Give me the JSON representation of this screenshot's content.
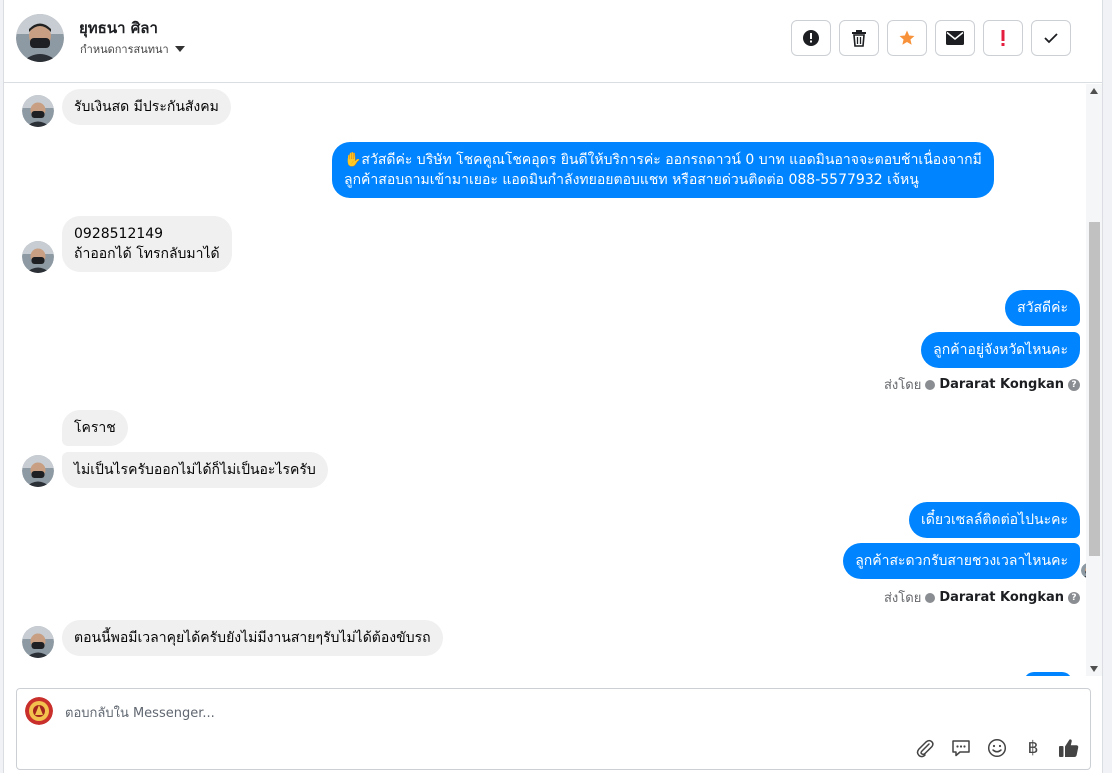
{
  "header": {
    "contact_name": "ยุทธนา ศิลา",
    "assign_label": "กำหนดการสนทนา"
  },
  "toolbar": {
    "icons": [
      "alert-circle-icon",
      "trash-icon",
      "star-icon",
      "envelope-icon",
      "exclamation-icon",
      "check-icon"
    ],
    "star_color": "#f7923a",
    "exclamation_color": "#e41e3f"
  },
  "messages": [
    {
      "side": "in",
      "text": "รับเงินสด มีประกันสังคม"
    },
    {
      "side": "out",
      "lines": [
        "✋สวัสดีค่ะ บริษัท โชคคูณโชคอุดร ยินดีให้บริการค่ะ ออกรถดาวน์ 0 บาท แอดมินอาจจะตอบช้าเนื่องจากมี",
        "ลูกค้าสอบถามเข้ามาเยอะ แอดมินกำลังทยอยตอบแชท หรือสายด่วนติดต่อ 088-5577932 เจ้หนู"
      ]
    },
    {
      "side": "in",
      "lines": [
        "0928512149",
        "ถ้าออกได้ โทรกลับมาได้"
      ]
    },
    {
      "side": "out",
      "text": "สวัสดีค่ะ"
    },
    {
      "side": "out",
      "text": "ลูกค้าอยู่จังหวัดไหนคะ"
    },
    {
      "side": "in",
      "text": "โคราช"
    },
    {
      "side": "in",
      "text": "ไม่เป็นไรครับออกไม่ได้ก็ไม่เป็นอะไรครับ"
    },
    {
      "side": "out",
      "text": "เดี๋ยวเซลล์ติดต่อไปนะคะ"
    },
    {
      "side": "out",
      "text": "ลูกค้าสะดวกรับสายชวงเวลาไหนคะ"
    },
    {
      "side": "in",
      "text": "ตอนนี้พอมีเวลาคุยได้ครับยังไม่มีงานสายๆรับไม่ได้ต้องขับรถ"
    }
  ],
  "sent_by": {
    "label": "ส่งโดย",
    "agent": "Dararat Kongkan",
    "help": "?"
  },
  "composer": {
    "placeholder": "ตอบกลับใน Messenger...",
    "tools": [
      "paperclip-icon",
      "saved-reply-icon",
      "emoji-icon",
      "baht-icon",
      "thumbs-up-icon"
    ],
    "baht_symbol": "฿"
  },
  "colors": {
    "outgoing_bubble": "#0084ff",
    "incoming_bubble": "#f0f0f0"
  }
}
